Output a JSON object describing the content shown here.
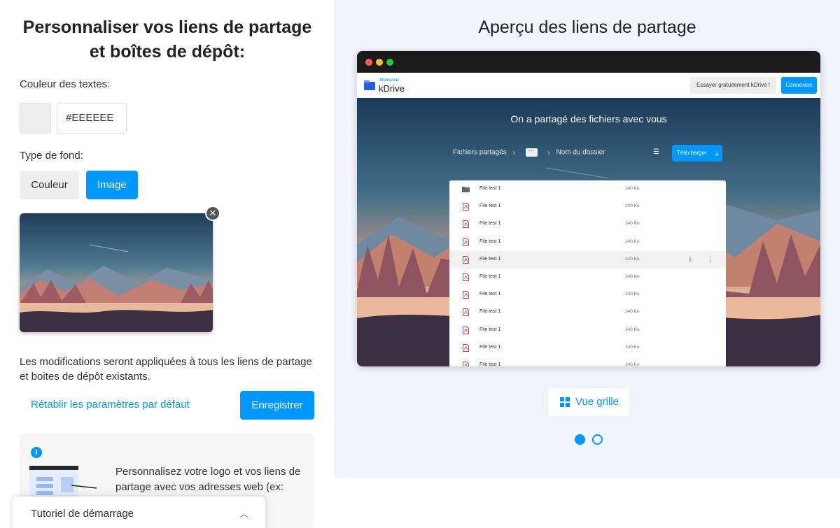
{
  "left": {
    "title_line1": "Personnaliser vos liens de partage",
    "title_line2": "et boîtes de dépôt:",
    "text_color_label": "Couleur des textes:",
    "text_color_value": "#EEEEEE",
    "background_type_label": "Type de fond:",
    "bg_options": [
      "Couleur",
      "Image"
    ],
    "bg_selected": "Image",
    "note_line1": "Les modifications seront appliquées à tous les liens de partage",
    "note_line2": "et boites de dépôt existants.",
    "reset_label": "Rétablir les paramètres par défaut",
    "save_label": "Enregistrer",
    "info_text_line1": "Personnalisez votre logo et vos liens de",
    "info_text_line2": "partage avec vos adresses web (ex:",
    "tutorial_label": "Tutoriel de démarrage"
  },
  "right": {
    "title": "Aperçu des liens de partage",
    "preview": {
      "logo_sub": "Infomaniak",
      "logo_main": "kDrive",
      "try_label": "Essayer gratuitement kDrive !",
      "login_label": "Connexion",
      "hero_title": "On a partagé des fichiers avec vous",
      "breadcrumb_root": "Fichiers partagés",
      "breadcrumb_folder_glyph": "···",
      "breadcrumb_current": "Nom du dossier",
      "download_label": "Télécharger",
      "files": [
        {
          "name": "File test 1",
          "size": "340 Ko",
          "type": "folder"
        },
        {
          "name": "File test 1",
          "size": "340 Ko",
          "type": "pdf"
        },
        {
          "name": "File test 1",
          "size": "340 Ko",
          "type": "pdf"
        },
        {
          "name": "File test 1",
          "size": "340 Ko",
          "type": "pdf"
        },
        {
          "name": "File test 1",
          "size": "340 Ko",
          "type": "pdf",
          "hover": true
        },
        {
          "name": "File test 1",
          "size": "340 Ko",
          "type": "pdf"
        },
        {
          "name": "File test 1",
          "size": "340 Ko",
          "type": "pdf"
        },
        {
          "name": "File test 1",
          "size": "340 Ko",
          "type": "pdf"
        },
        {
          "name": "File test 1",
          "size": "340 Ko",
          "type": "pdf"
        },
        {
          "name": "File test 1",
          "size": "340 Ko",
          "type": "pdf"
        },
        {
          "name": "File test 1",
          "size": "340 Ko",
          "type": "pdf"
        }
      ]
    },
    "grid_label": "Vue grille",
    "pager": {
      "count": 2,
      "active": 1
    }
  },
  "colors": {
    "accent": "#0098ff",
    "right_bg": "#f1f4fb",
    "text_color_swatch": "#EEEEEE"
  }
}
